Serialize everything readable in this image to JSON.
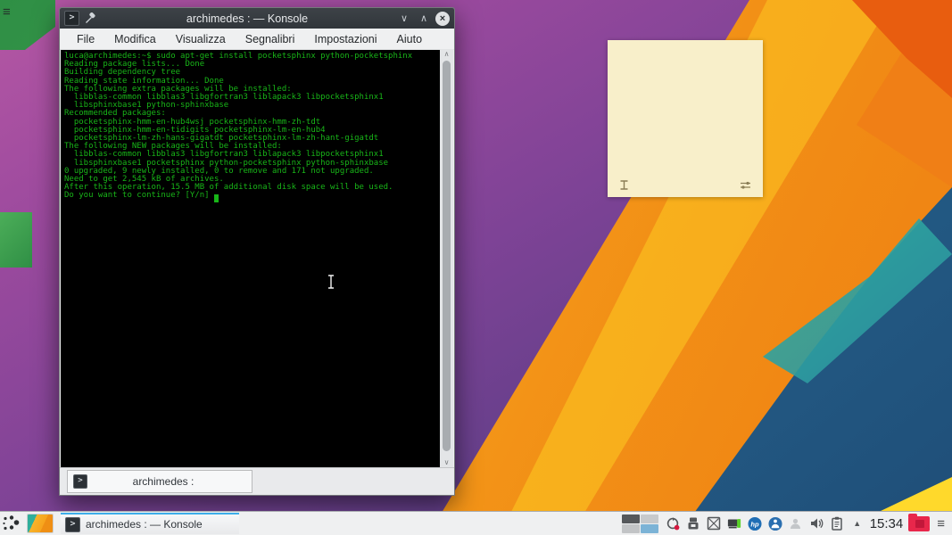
{
  "window": {
    "title": "archimedes : — Konsole",
    "menu": {
      "items": [
        "File",
        "Modifica",
        "Visualizza",
        "Segnalibri",
        "Impostazioni",
        "Aiuto"
      ]
    },
    "tab": {
      "label": "archimedes :"
    }
  },
  "terminal": {
    "lines": [
      "luca@archimedes:~$ sudo apt-get install pocketsphinx python-pocketsphinx",
      "Reading package lists... Done",
      "Building dependency tree",
      "Reading state information... Done",
      "The following extra packages will be installed:",
      "  libblas-common libblas3 libgfortran3 liblapack3 libpocketsphinx1",
      "  libsphinxbase1 python-sphinxbase",
      "Recommended packages:",
      "  pocketsphinx-hmm-en-hub4wsj pocketsphinx-hmm-zh-tdt",
      "  pocketsphinx-hmm-en-tidigits pocketsphinx-lm-en-hub4",
      "  pocketsphinx-lm-zh-hans-gigatdt pocketsphinx-lm-zh-hant-gigatdt",
      "The following NEW packages will be installed:",
      "  libblas-common libblas3 libgfortran3 liblapack3 libpocketsphinx1",
      "  libsphinxbase1 pocketsphinx python-pocketsphinx python-sphinxbase",
      "0 upgraded, 9 newly installed, 0 to remove and 171 not upgraded.",
      "Need to get 2,545 kB of archives.",
      "After this operation, 15.5 MB of additional disk space will be used.",
      "Do you want to continue? [Y/n] "
    ]
  },
  "taskbar": {
    "task_label": "archimedes : — Konsole",
    "clock": "15:34"
  },
  "icons": {
    "prompt_glyph": ">",
    "minimize_glyph": "∨",
    "maximize_glyph": "∧",
    "close_glyph": "×",
    "scroll_up_glyph": "∧",
    "scroll_down_glyph": "∨",
    "tray_expand_glyph": "▲",
    "hamburger_glyph": "≡",
    "hp_label": "hp"
  },
  "colors": {
    "accent": "#3daee9",
    "terminal_green": "#18b518",
    "titlebar_bg": "#31363b",
    "panel_bg": "#eff0f1",
    "note_bg": "#f8efca"
  }
}
